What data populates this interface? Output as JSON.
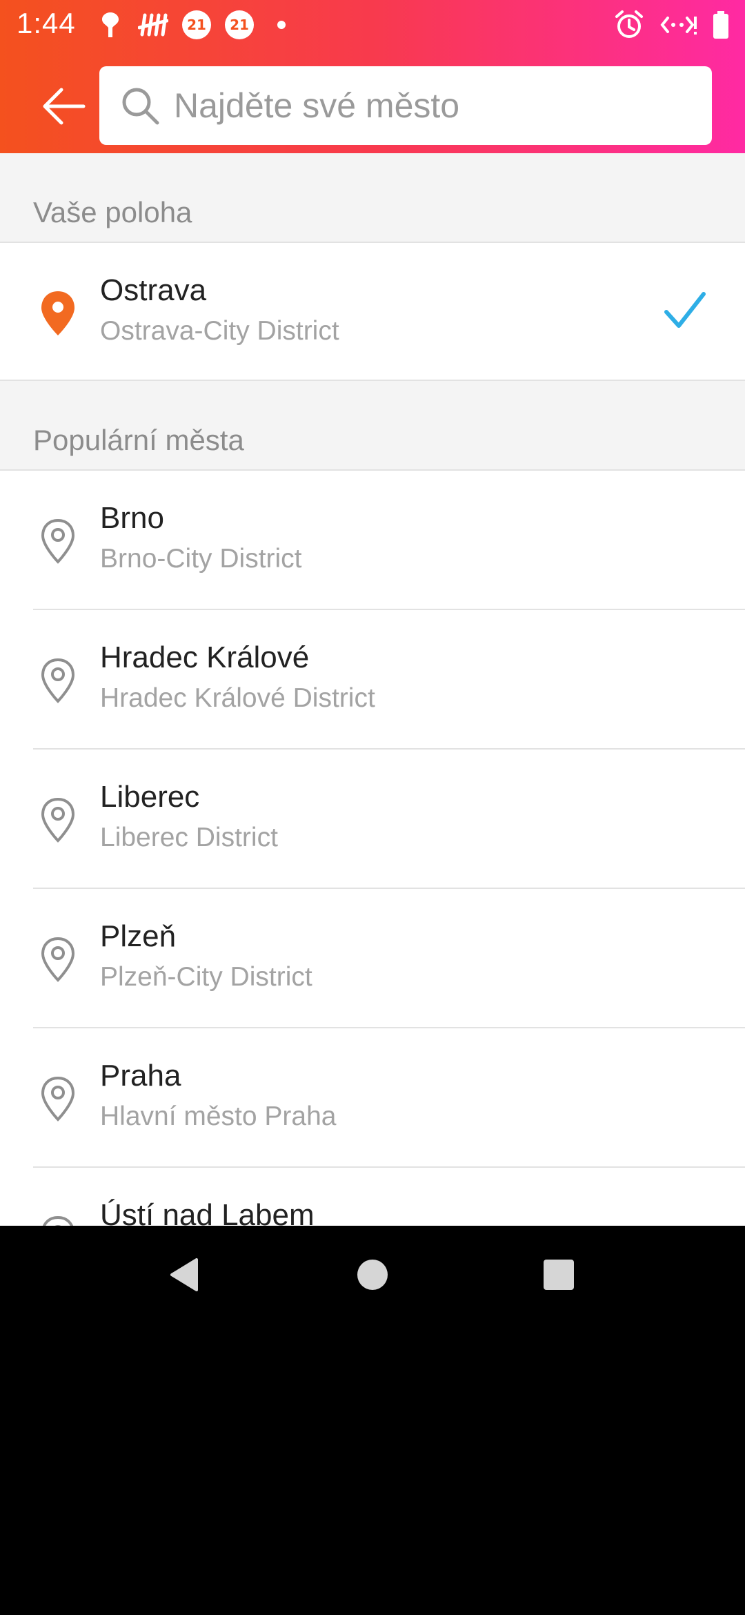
{
  "status_bar": {
    "time": "1:44",
    "left_icons": [
      "drop-icon",
      "tally-icon",
      "badge-21-icon",
      "badge-21-icon",
      "notification-dot-icon"
    ],
    "badge_text": "21",
    "right_icons": [
      "alarm-icon",
      "data-sync-icon",
      "battery-icon"
    ]
  },
  "header": {
    "gradient_colors": [
      "#f4511e",
      "#f83a4d",
      "#ff2aa3"
    ],
    "search": {
      "placeholder": "Najděte své město",
      "value": ""
    }
  },
  "current_location": {
    "section_title": "Vaše poloha",
    "title": "Ostrava",
    "subtitle": "Ostrava-City District",
    "selected": true,
    "pin_color": "#f26a21",
    "check_color": "#2eaee6"
  },
  "popular": {
    "section_title": "Populární města",
    "items": [
      {
        "title": "Brno",
        "subtitle": "Brno-City District"
      },
      {
        "title": "Hradec Králové",
        "subtitle": "Hradec Králové District"
      },
      {
        "title": "Liberec",
        "subtitle": "Liberec District"
      },
      {
        "title": "Plzeň",
        "subtitle": "Plzeň-City District"
      },
      {
        "title": "Praha",
        "subtitle": "Hlavní město Praha"
      },
      {
        "title": "Ústí nad Labem",
        "subtitle": ""
      }
    ]
  },
  "nav_bar": {
    "buttons": [
      "back-icon",
      "home-icon",
      "recents-icon"
    ]
  }
}
